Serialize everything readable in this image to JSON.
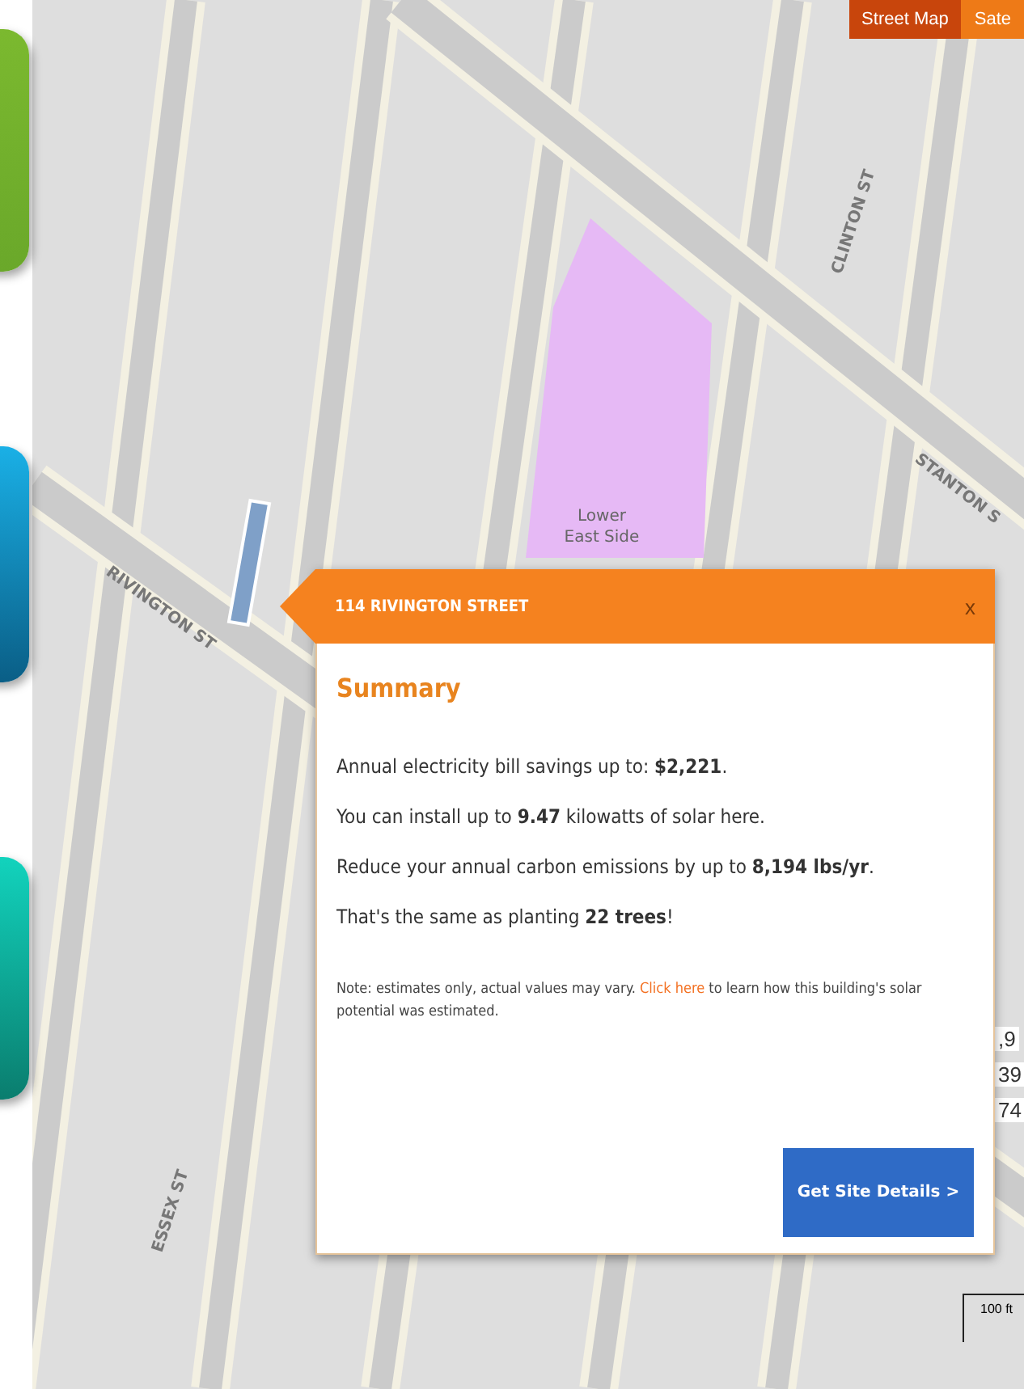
{
  "map_toggle": [
    {
      "label": "Street Map",
      "selected": true
    },
    {
      "label": "Sate",
      "selected": false
    }
  ],
  "map": {
    "street_labels": [
      {
        "text": "CLINTON ST"
      },
      {
        "text": "STANTON S"
      },
      {
        "text": "RIVINGTON ST"
      },
      {
        "text": "ESSEX ST"
      }
    ],
    "place_label": [
      "Lower",
      "East Side"
    ],
    "edge_numbers": [
      ",9",
      "39",
      "74"
    ],
    "scale": "100 ft"
  },
  "popup": {
    "title": "114 RIVINGTON STREET",
    "close": "x",
    "heading": "Summary",
    "facts": [
      "Annual electricity bill savings up to: **$2,221**.",
      "You can install up to **9.47** kilowatts of solar here.",
      "Reduce your annual carbon emissions by up to **8,194 lbs/yr**.",
      "That's the same as planting **22 trees**!"
    ],
    "note_before": "Note: estimates only, actual values may vary. ",
    "note_link": "Click here",
    "note_after": " to learn how this building's solar potential was estimated.",
    "button": "Get Site Details >"
  }
}
